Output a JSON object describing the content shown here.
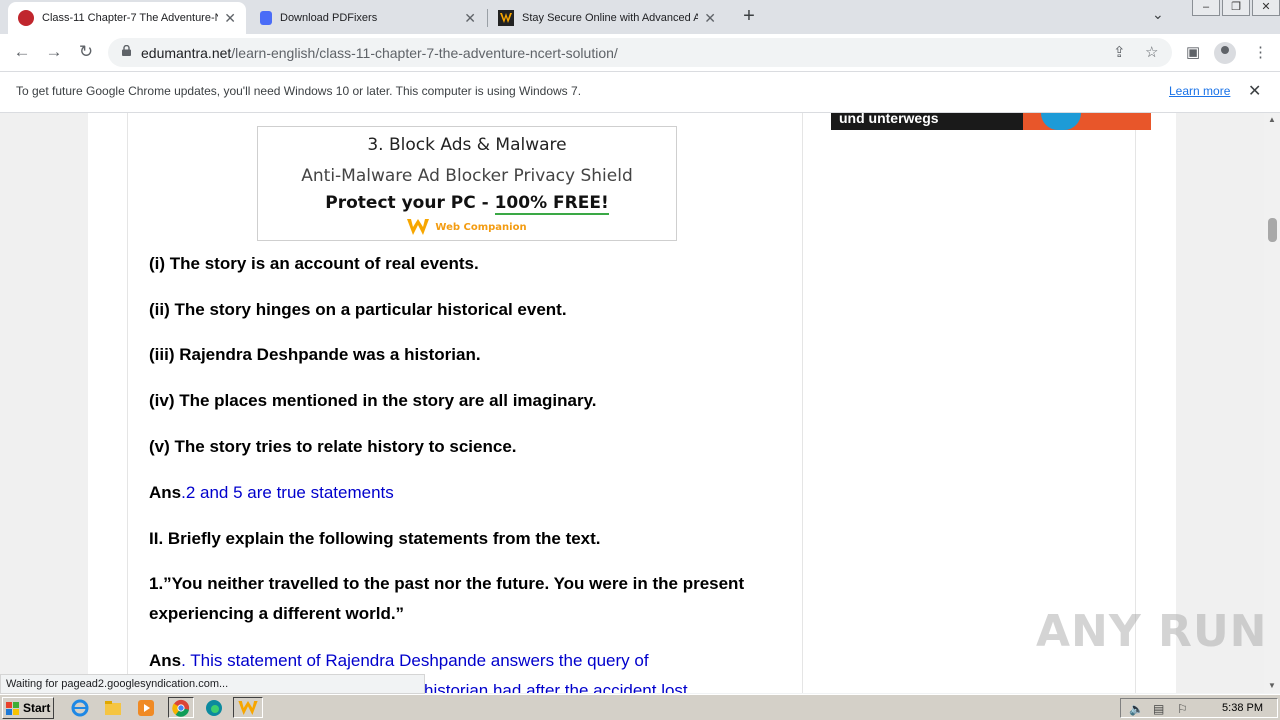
{
  "tabs": [
    {
      "title": "Class-11 Chapter-7 The Adventure-N",
      "icon": "edumantra-icon",
      "active": true
    },
    {
      "title": "Download PDFixers",
      "icon": "pdfixers-icon",
      "active": false
    },
    {
      "title": "Stay Secure Online with Advanced A",
      "icon": "webcompanion-icon",
      "active": false
    }
  ],
  "toolbar": {
    "url_host": "edumantra.net",
    "url_path": "/learn-english/class-11-chapter-7-the-adventure-ncert-solution/"
  },
  "infobar": {
    "message": "To get future Google Chrome updates, you'll need Windows 10 or later. This computer is using Windows 7.",
    "link": "Learn more"
  },
  "sidebar_ad": {
    "text": "und unterwegs"
  },
  "ad": {
    "line1": "3. Block Ads & Malware",
    "line2": "Anti-Malware Ad Blocker Privacy Shield",
    "line3_a": "Protect your PC - ",
    "line3_b": "100% FREE!",
    "brand": "Web Companion"
  },
  "article": {
    "statements": [
      "(i) The story is an account of real events.",
      "(ii) The story hinges on a particular historical event.",
      "(iii) Rajendra Deshpande was a historian.",
      "(iv) The places mentioned in the story are all imaginary.",
      "(v) The story tries to relate history to science."
    ],
    "ans1_label": "Ans",
    "ans1_value": ".2 and 5 are true statements",
    "section2": "II. Briefly explain the following statements from the text.",
    "q1": "1.”You neither travelled to the past nor the future. You were in the present experiencing a different world.”",
    "ans2_label": "Ans",
    "ans2_value": ". This statement of Rajendra Deshpande answers the query of",
    "ans2_line2": "historian had after the accident lost"
  },
  "status": "Waiting for pagead2.googlesyndication.com...",
  "watermark": "ANY RUN",
  "taskbar": {
    "start": "Start",
    "clock": "5:38 PM"
  },
  "colors": {
    "answer_blue": "#0000cc",
    "chrome_link": "#1a73e8"
  }
}
